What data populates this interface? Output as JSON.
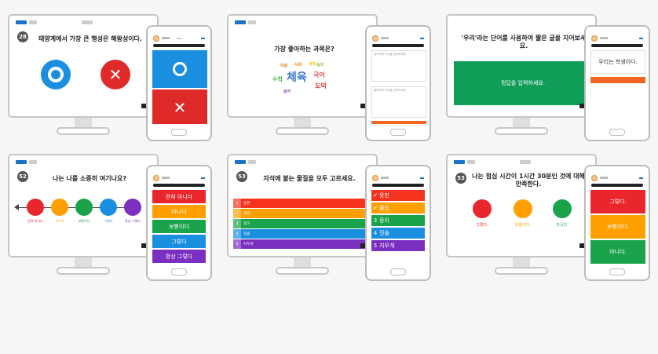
{
  "screens": [
    {
      "question_number": "28",
      "question": "태양계에서 가장 큰 행성은 해왕성이다.",
      "o_symbol": "O",
      "x_symbol": "✕",
      "o_color": "#1a8fe0",
      "x_color": "#e02a2a"
    },
    {
      "question": "가장 좋아하는 과목은?",
      "words": [
        "체육",
        "국어",
        "수학",
        "사회",
        "과학",
        "미술",
        "음악",
        "도덕",
        "실과"
      ],
      "word_colors": [
        "#3a7bd5",
        "#d9534f",
        "#4caf50",
        "#ff7f0e",
        "#f1c40f",
        "#e67e22",
        "#9b59b6",
        "#e53935",
        "#8bc34a"
      ],
      "phone_placeholder_1": "클릭하여 의견을 입력하세요.",
      "phone_placeholder_2": "클릭하여 의견을 입력하세요.",
      "submit_color": "#f26522"
    },
    {
      "question": "'우리'라는 단어를 사용하여 짧은 글을 지어보세요.",
      "answer_prompt": "정답을 입력하세요.",
      "answer_color": "#0f9d58",
      "phone_answer": "우리는 학생이다.",
      "phone_submit_color": "#f26522"
    },
    {
      "question_number": "52",
      "question": "나는 나를 소중히 여기나요?",
      "scale": [
        {
          "label": "전혀 아니다",
          "color": "#e8262b"
        },
        {
          "label": "아니다",
          "color": "#ff9f00"
        },
        {
          "label": "보통이다",
          "color": "#1aa34a"
        },
        {
          "label": "그렇다",
          "color": "#1a8fe0"
        },
        {
          "label": "항상 그렇다",
          "color": "#7a2fc0"
        }
      ]
    },
    {
      "question_number": "53",
      "question": "자석에 붙는 물질을 모두 고르세요.",
      "options": [
        {
          "num": "1",
          "label": "옷핀",
          "color": "#f5331f",
          "checked": true
        },
        {
          "num": "2",
          "label": "클립",
          "color": "#ff9f00",
          "checked": true
        },
        {
          "num": "3",
          "label": "종이",
          "color": "#1aa34a",
          "checked": false
        },
        {
          "num": "4",
          "label": "짓솔",
          "color": "#1a8fe0",
          "checked": false
        },
        {
          "num": "5",
          "label": "지우개",
          "color": "#7a2fc0",
          "checked": false
        }
      ],
      "monitor_options": [
        {
          "num": "1",
          "label": "옷핀"
        },
        {
          "num": "2",
          "label": "클립"
        },
        {
          "num": "3",
          "label": "종이"
        },
        {
          "num": "4",
          "label": "짓솔"
        },
        {
          "num": "5",
          "label": "지우개"
        }
      ],
      "phone_checkmark": "✔"
    },
    {
      "question_number": "53",
      "question": "나는 점심 시간이 1시간 30분인 것에 대해 만족한다.",
      "choices": [
        {
          "label": "그렇다.",
          "color": "#e8262b"
        },
        {
          "label": "보통이다.",
          "color": "#ff9f00"
        },
        {
          "label": "아니다.",
          "color": "#1aa34a"
        }
      ]
    }
  ]
}
